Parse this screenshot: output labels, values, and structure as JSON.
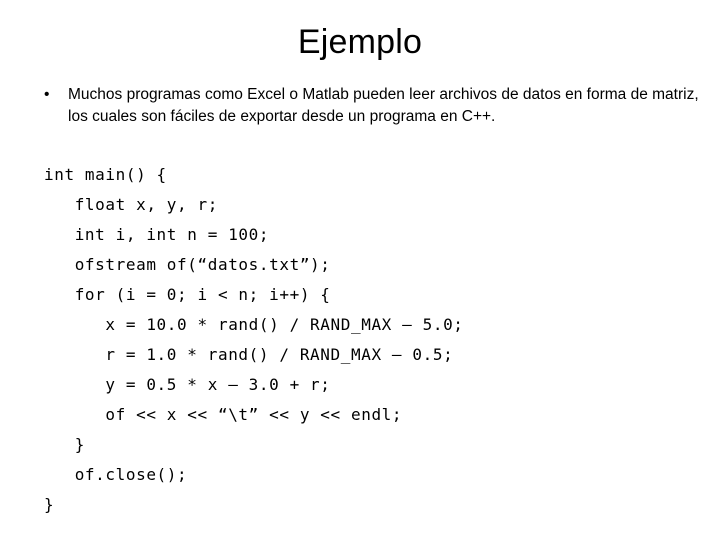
{
  "slide": {
    "title": "Ejemplo",
    "bullets": [
      {
        "marker": "•",
        "text": "Muchos programas como Excel o Matlab pueden leer archivos de datos en forma de matriz, los cuales son fáciles de exportar desde un programa en C++."
      }
    ],
    "code": {
      "language": "C++",
      "lines": [
        "int main() {",
        "   float x, y, r;",
        "   int i, int n = 100;",
        "   ofstream of(“datos.txt”);",
        "   for (i = 0; i < n; i++) {",
        "      x = 10.0 * rand() / RAND_MAX – 5.0;",
        "      r = 1.0 * rand() / RAND_MAX – 0.5;",
        "      y = 0.5 * x – 3.0 + r;",
        "      of << x << “\\t” << y << endl;",
        "   }",
        "   of.close();",
        "}"
      ]
    },
    "colors": {
      "background": "#ffffff",
      "text": "#000000"
    }
  }
}
